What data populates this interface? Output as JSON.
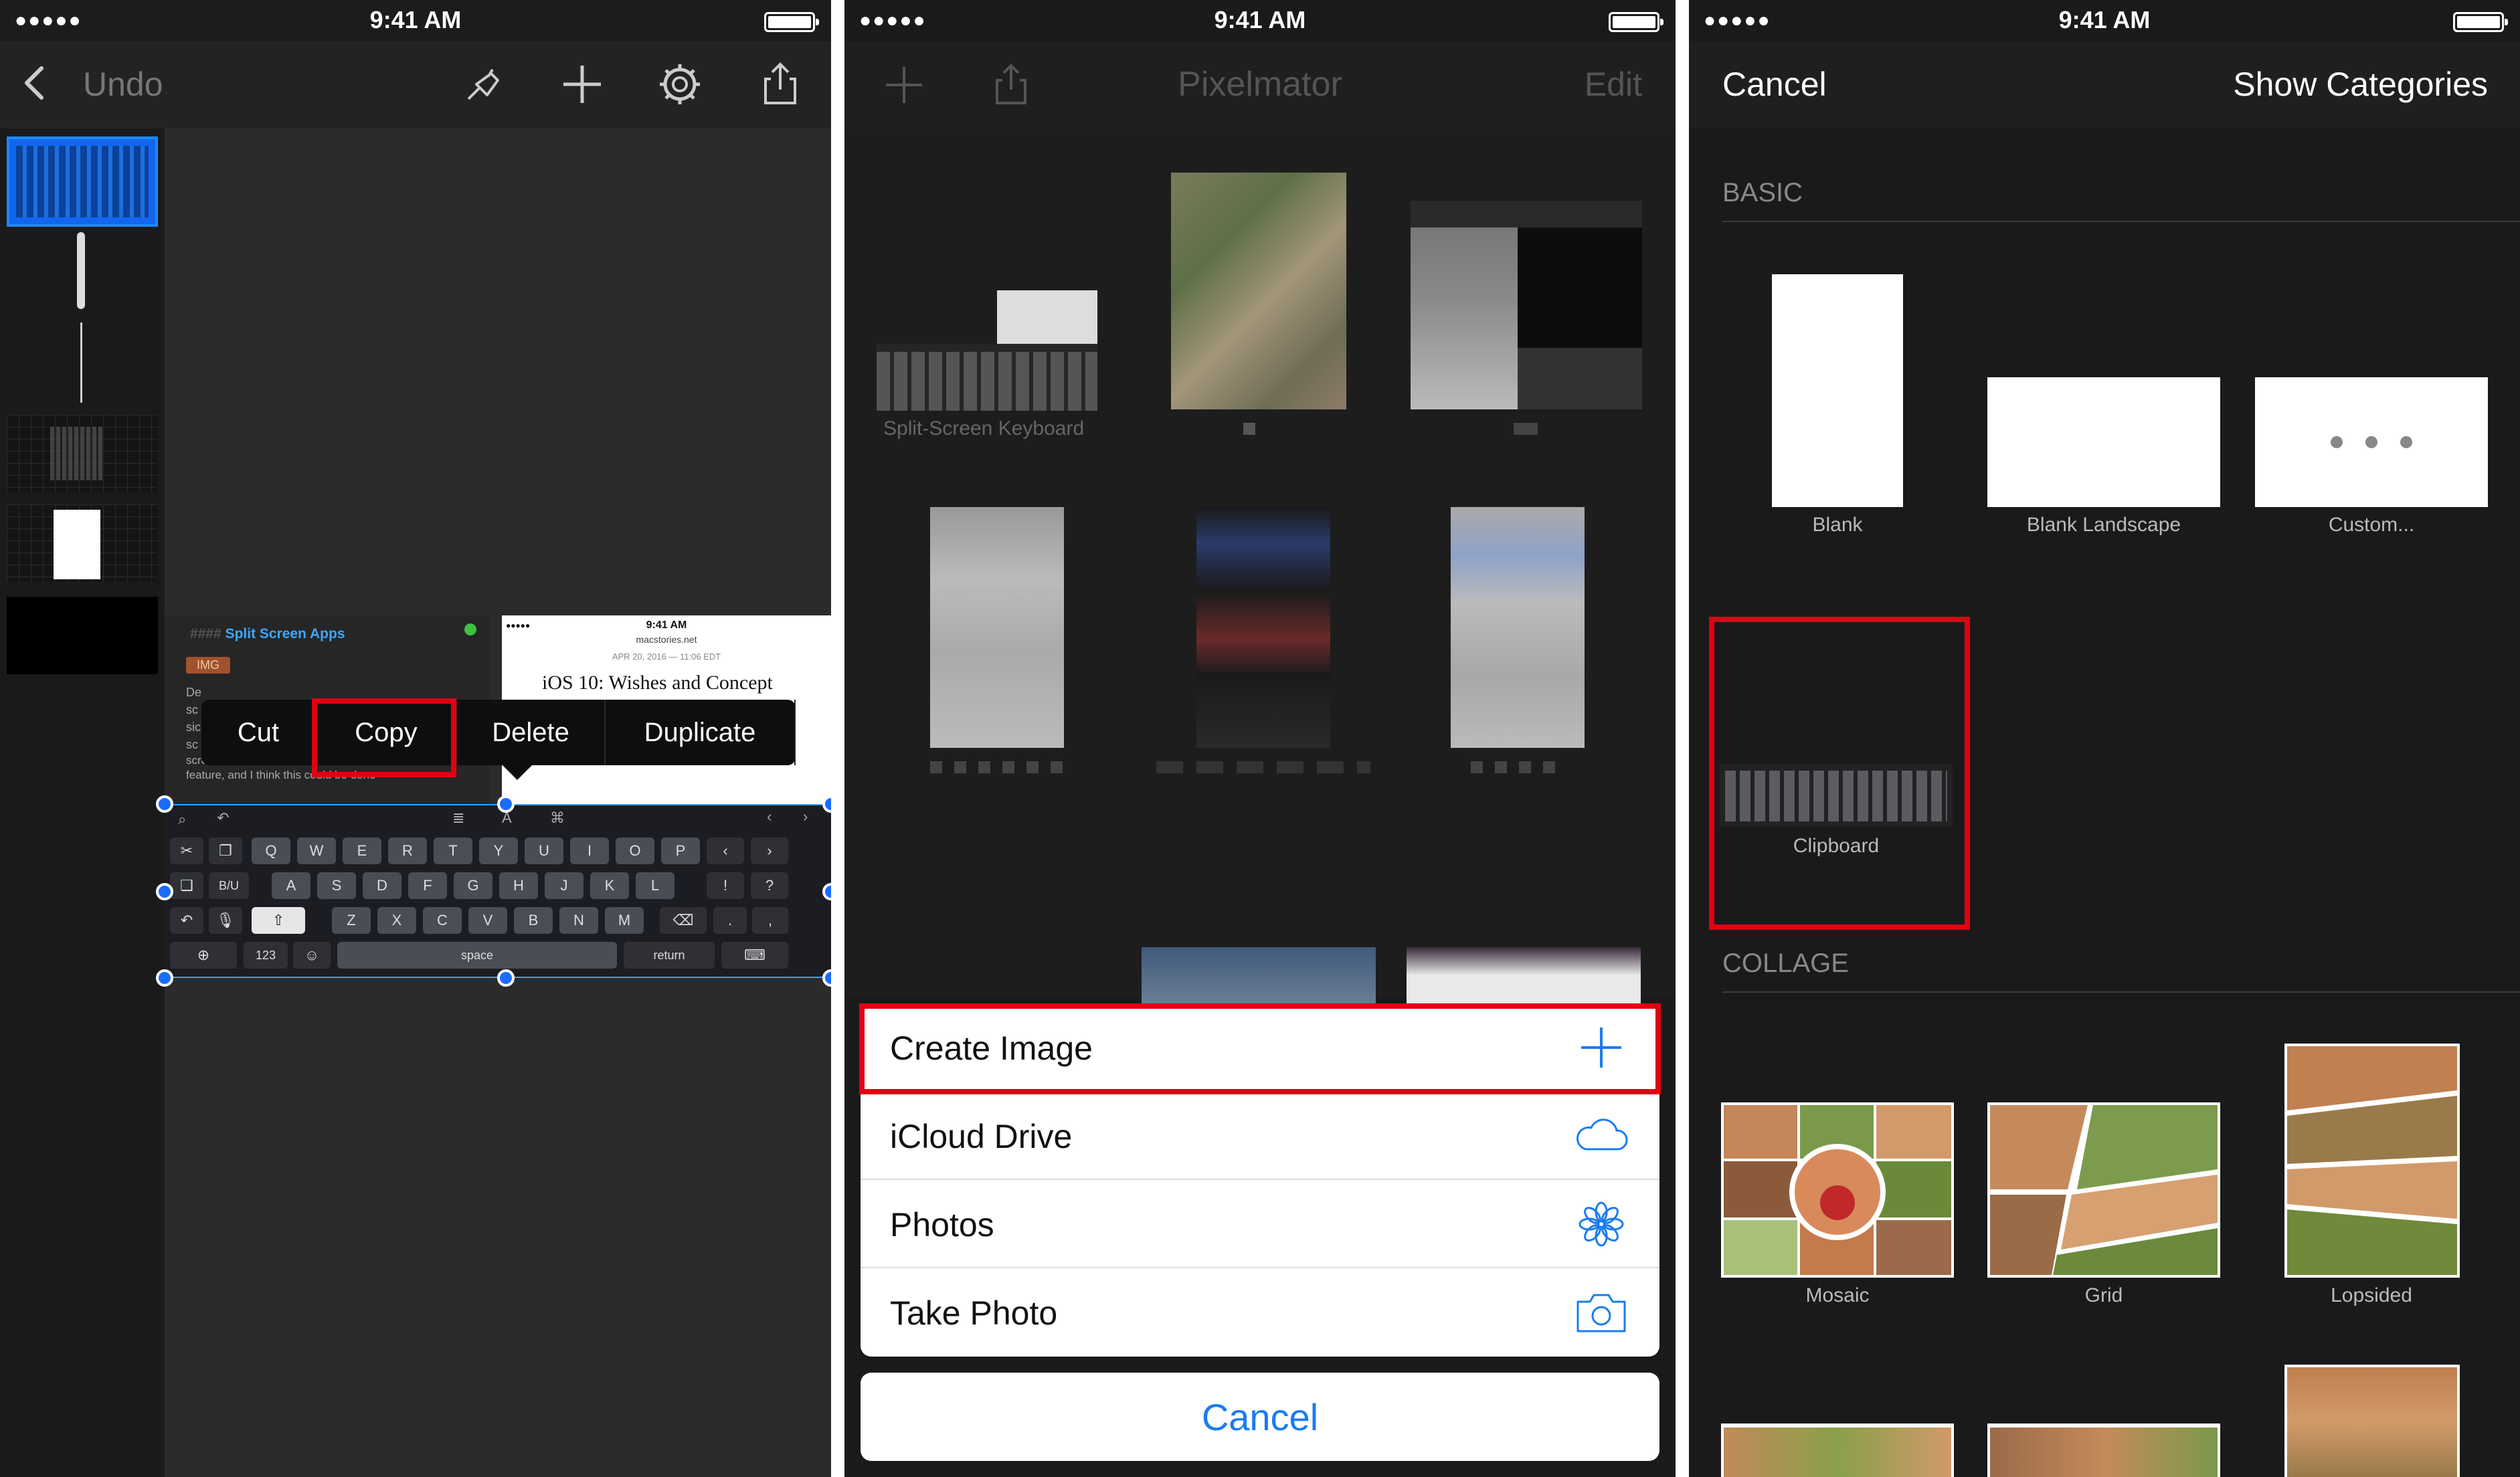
{
  "status_bar": {
    "signal": "●●●●●",
    "time": "9:41 AM"
  },
  "highlight_color": "#e00013",
  "phone1": {
    "undo_label": "Undo",
    "toolbar_icons": [
      "back-icon",
      "brush-icon",
      "plus-icon",
      "gear-icon",
      "share-icon"
    ],
    "document_left": {
      "header_hash": "####",
      "header": "Split Screen Apps",
      "tag": "IMG",
      "lines": [
        "De",
        "sc",
        "sic",
        "sc",
        "screen on an iPad Nano. Android has this",
        "feature, and I think this could be done"
      ]
    },
    "document_right": {
      "time": "9:41 AM",
      "site": "macstories.net",
      "date": "APR 20, 2016 — 11:06 EDT",
      "title": "iOS 10: Wishes and Concept"
    },
    "context_menu": [
      "Cut",
      "Copy",
      "Delete",
      "Duplicate"
    ],
    "keyboard": {
      "row1": [
        "Q",
        "W",
        "E",
        "R",
        "T",
        "Y",
        "U",
        "I",
        "O",
        "P"
      ],
      "row2": [
        "A",
        "S",
        "D",
        "F",
        "G",
        "H",
        "J",
        "K",
        "L"
      ],
      "row3": [
        "Z",
        "X",
        "C",
        "V",
        "B",
        "N",
        "M"
      ],
      "biu": "B/U",
      "num": "123",
      "space": "space",
      "return": "return",
      "punct": [
        "!",
        "?",
        ".",
        ","
      ]
    }
  },
  "phone2": {
    "title": "Pixelmator",
    "edit_label": "Edit",
    "first_caption": "Split-Screen Keyboard",
    "actions": [
      {
        "label": "Create Image",
        "icon": "plus-icon"
      },
      {
        "label": "iCloud Drive",
        "icon": "cloud-icon"
      },
      {
        "label": "Photos",
        "icon": "photos-flower-icon"
      },
      {
        "label": "Take Photo",
        "icon": "camera-icon"
      }
    ],
    "cancel_label": "Cancel",
    "accent": "#1a7cf0"
  },
  "phone3": {
    "cancel_label": "Cancel",
    "show_categories_label": "Show Categories",
    "basic_header": "BASIC",
    "basic_templates": [
      "Blank",
      "Blank Landscape",
      "Custom...",
      "Clipboard"
    ],
    "collage_header": "COLLAGE",
    "collage_templates": [
      "Mosaic",
      "Grid",
      "Lopsided"
    ]
  }
}
